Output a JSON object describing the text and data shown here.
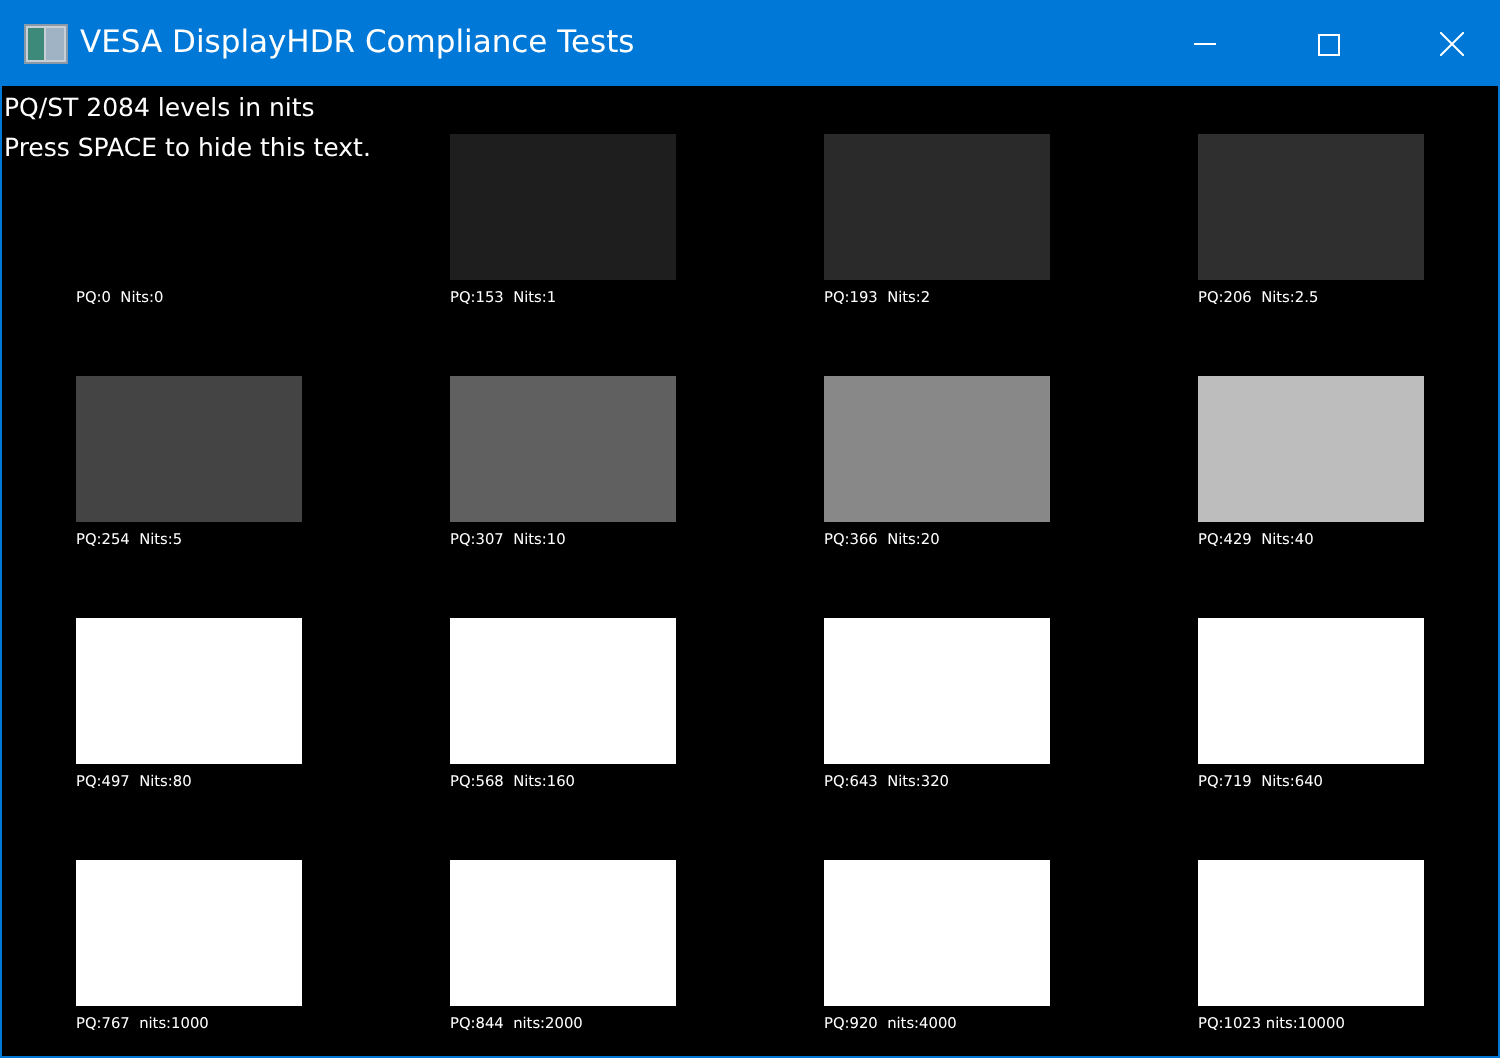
{
  "window": {
    "title": "VESA DisplayHDR Compliance Tests"
  },
  "instructions": [
    "PQ/ST 2084 levels in nits",
    "Press SPACE to hide this text."
  ],
  "tiles": [
    {
      "label": "PQ:0  Nits:0"
    },
    {
      "label": "PQ:153  Nits:1",
      "color": "#1e1e1e"
    },
    {
      "label": "PQ:193  Nits:2",
      "color": "#2a2a2a"
    },
    {
      "label": "PQ:206  Nits:2.5",
      "color": "#2f2f2f"
    },
    {
      "label": "PQ:254  Nits:5",
      "color": "#444444"
    },
    {
      "label": "PQ:307  Nits:10",
      "color": "#606060"
    },
    {
      "label": "PQ:366  Nits:20",
      "color": "#888888"
    },
    {
      "label": "PQ:429  Nits:40",
      "color": "#bdbdbd"
    },
    {
      "label": "PQ:497  Nits:80",
      "color": "#ffffff"
    },
    {
      "label": "PQ:568  Nits:160",
      "color": "#ffffff"
    },
    {
      "label": "PQ:643  Nits:320",
      "color": "#ffffff"
    },
    {
      "label": "PQ:719  Nits:640",
      "color": "#ffffff"
    },
    {
      "label": "PQ:767  nits:1000",
      "color": "#ffffff"
    },
    {
      "label": "PQ:844  nits:2000",
      "color": "#ffffff"
    },
    {
      "label": "PQ:920  nits:4000",
      "color": "#ffffff"
    },
    {
      "label": "PQ:1023 nits:10000",
      "color": "#ffffff"
    }
  ]
}
